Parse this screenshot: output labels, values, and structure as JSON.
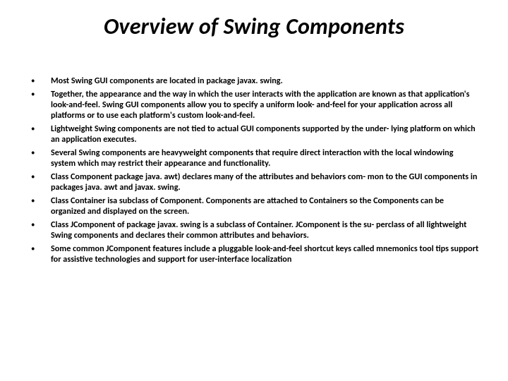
{
  "title": "Overview of Swing Components",
  "bullets": [
    "Most Swing GUI components  are located in package javax. swing.",
    "Together, the appearance and the way in which the user interacts with the application are known as that application's look-and-feel. Swing GUI components allow you to specify a uniform look- and-feel for your application across all platforms or to use each platform's custom look-and-feel.",
    "Lightweight Swing components are not tied to actual GUI components supported by the under- lying platform on which an application executes.",
    "Several Swing components are heavyweight components  that require direct interaction with the local windowing system  which may restrict their appearance and functionality.",
    "Class Component package java. awt) declares many of the attributes and behaviors com- mon to the GUI components in packages java. awt  and javax. swing.",
    "Class Container isa subclass of Component. Components are attached to Containers so the Components can be organized and displayed on the screen.",
    "Class JComponent  of package javax. swing is a subclass of Container. JComponent is the su- perclass of all lightweight Swing components and declares their common attributes and behaviors.",
    "Some common JComponent features include a pluggable look-and-feel shortcut keys called mnemonics tool tips  support for assistive technologies and support for user-interface localization"
  ]
}
